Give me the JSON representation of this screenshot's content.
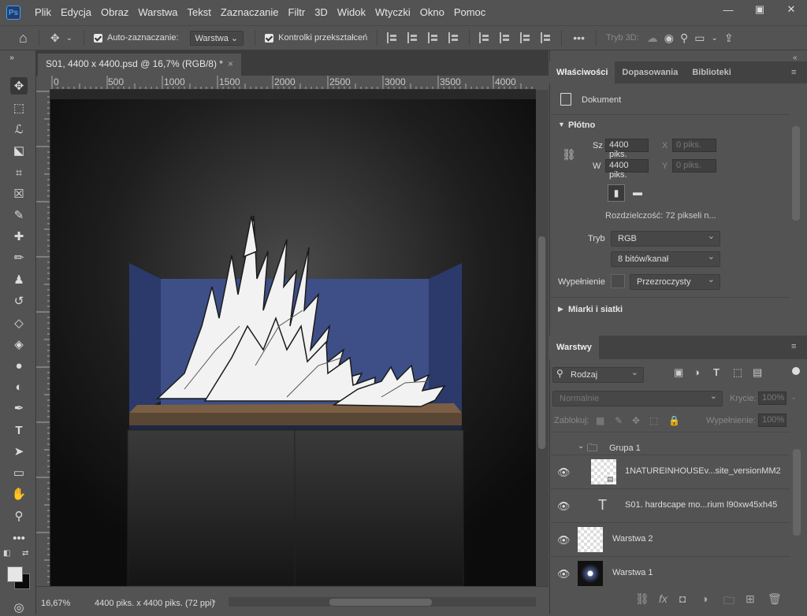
{
  "app": {
    "logo": "Ps",
    "menus": [
      "Plik",
      "Edycja",
      "Obraz",
      "Warstwa",
      "Tekst",
      "Zaznaczanie",
      "Filtr",
      "3D",
      "Widok",
      "Wtyczki",
      "Okno",
      "Pomoc"
    ]
  },
  "options": {
    "auto_select_label": "Auto-zaznaczanie:",
    "auto_select_value": "Warstwa",
    "transform_label": "Kontrolki przekształceń",
    "mode3d": "Tryb 3D:",
    "more": "•••"
  },
  "document": {
    "tab_title": "S01, 4400 x 4400.psd @ 16,7% (RGB/8) *",
    "close": "×",
    "zoom": "16,67%",
    "info": "4400 piks. x 4400 piks. (72 ppi)"
  },
  "ruler": {
    "top_ticks": [
      "0",
      "500",
      "1000",
      "1500",
      "2000",
      "2500",
      "3000",
      "3500",
      "4000"
    ]
  },
  "properties": {
    "tabs": [
      "Właściwości",
      "Dopasowania",
      "Biblioteki"
    ],
    "doc_label": "Dokument",
    "canvas_section": "Płótno",
    "w_label": "Sz",
    "w_value": "4400 piks.",
    "h_label": "W",
    "h_value": "4400 piks.",
    "x_label": "X",
    "x_value": "0 piks.",
    "y_label": "Y",
    "y_value": "0 piks.",
    "resolution": "Rozdzielczość: 72 pikseli n...",
    "mode_label": "Tryb",
    "mode_value": "RGB",
    "depth_value": "8 bitów/kanał",
    "fill_label": "Wypełnienie",
    "fill_value": "Przezroczysty",
    "rulers_section": "Miarki i siatki"
  },
  "layers": {
    "tab": "Warstwy",
    "kind": "Rodzaj",
    "blend": "Normalnie",
    "opacity_label": "Krycie:",
    "opacity_value": "100%",
    "lock_label": "Zablokuj:",
    "fill_label": "Wypełnienie:",
    "fill_value": "100%",
    "items": [
      {
        "name": "Grupa 1",
        "type": "group",
        "visible": false
      },
      {
        "name": "1NATUREINHOUSEv...site_versionMM2",
        "type": "smart",
        "visible": true
      },
      {
        "name": "S01. hardscape mo...rium l90xw45xh45",
        "type": "text",
        "visible": true
      },
      {
        "name": "Warstwa 2",
        "type": "pixel",
        "visible": true
      },
      {
        "name": "Warstwa 1",
        "type": "pixel",
        "visible": true
      }
    ]
  },
  "colors": {
    "accent": "#31a8ff",
    "tank_blue": "#3d4f86",
    "rock": "#f2f2f2",
    "sand": "#7a5f44"
  }
}
